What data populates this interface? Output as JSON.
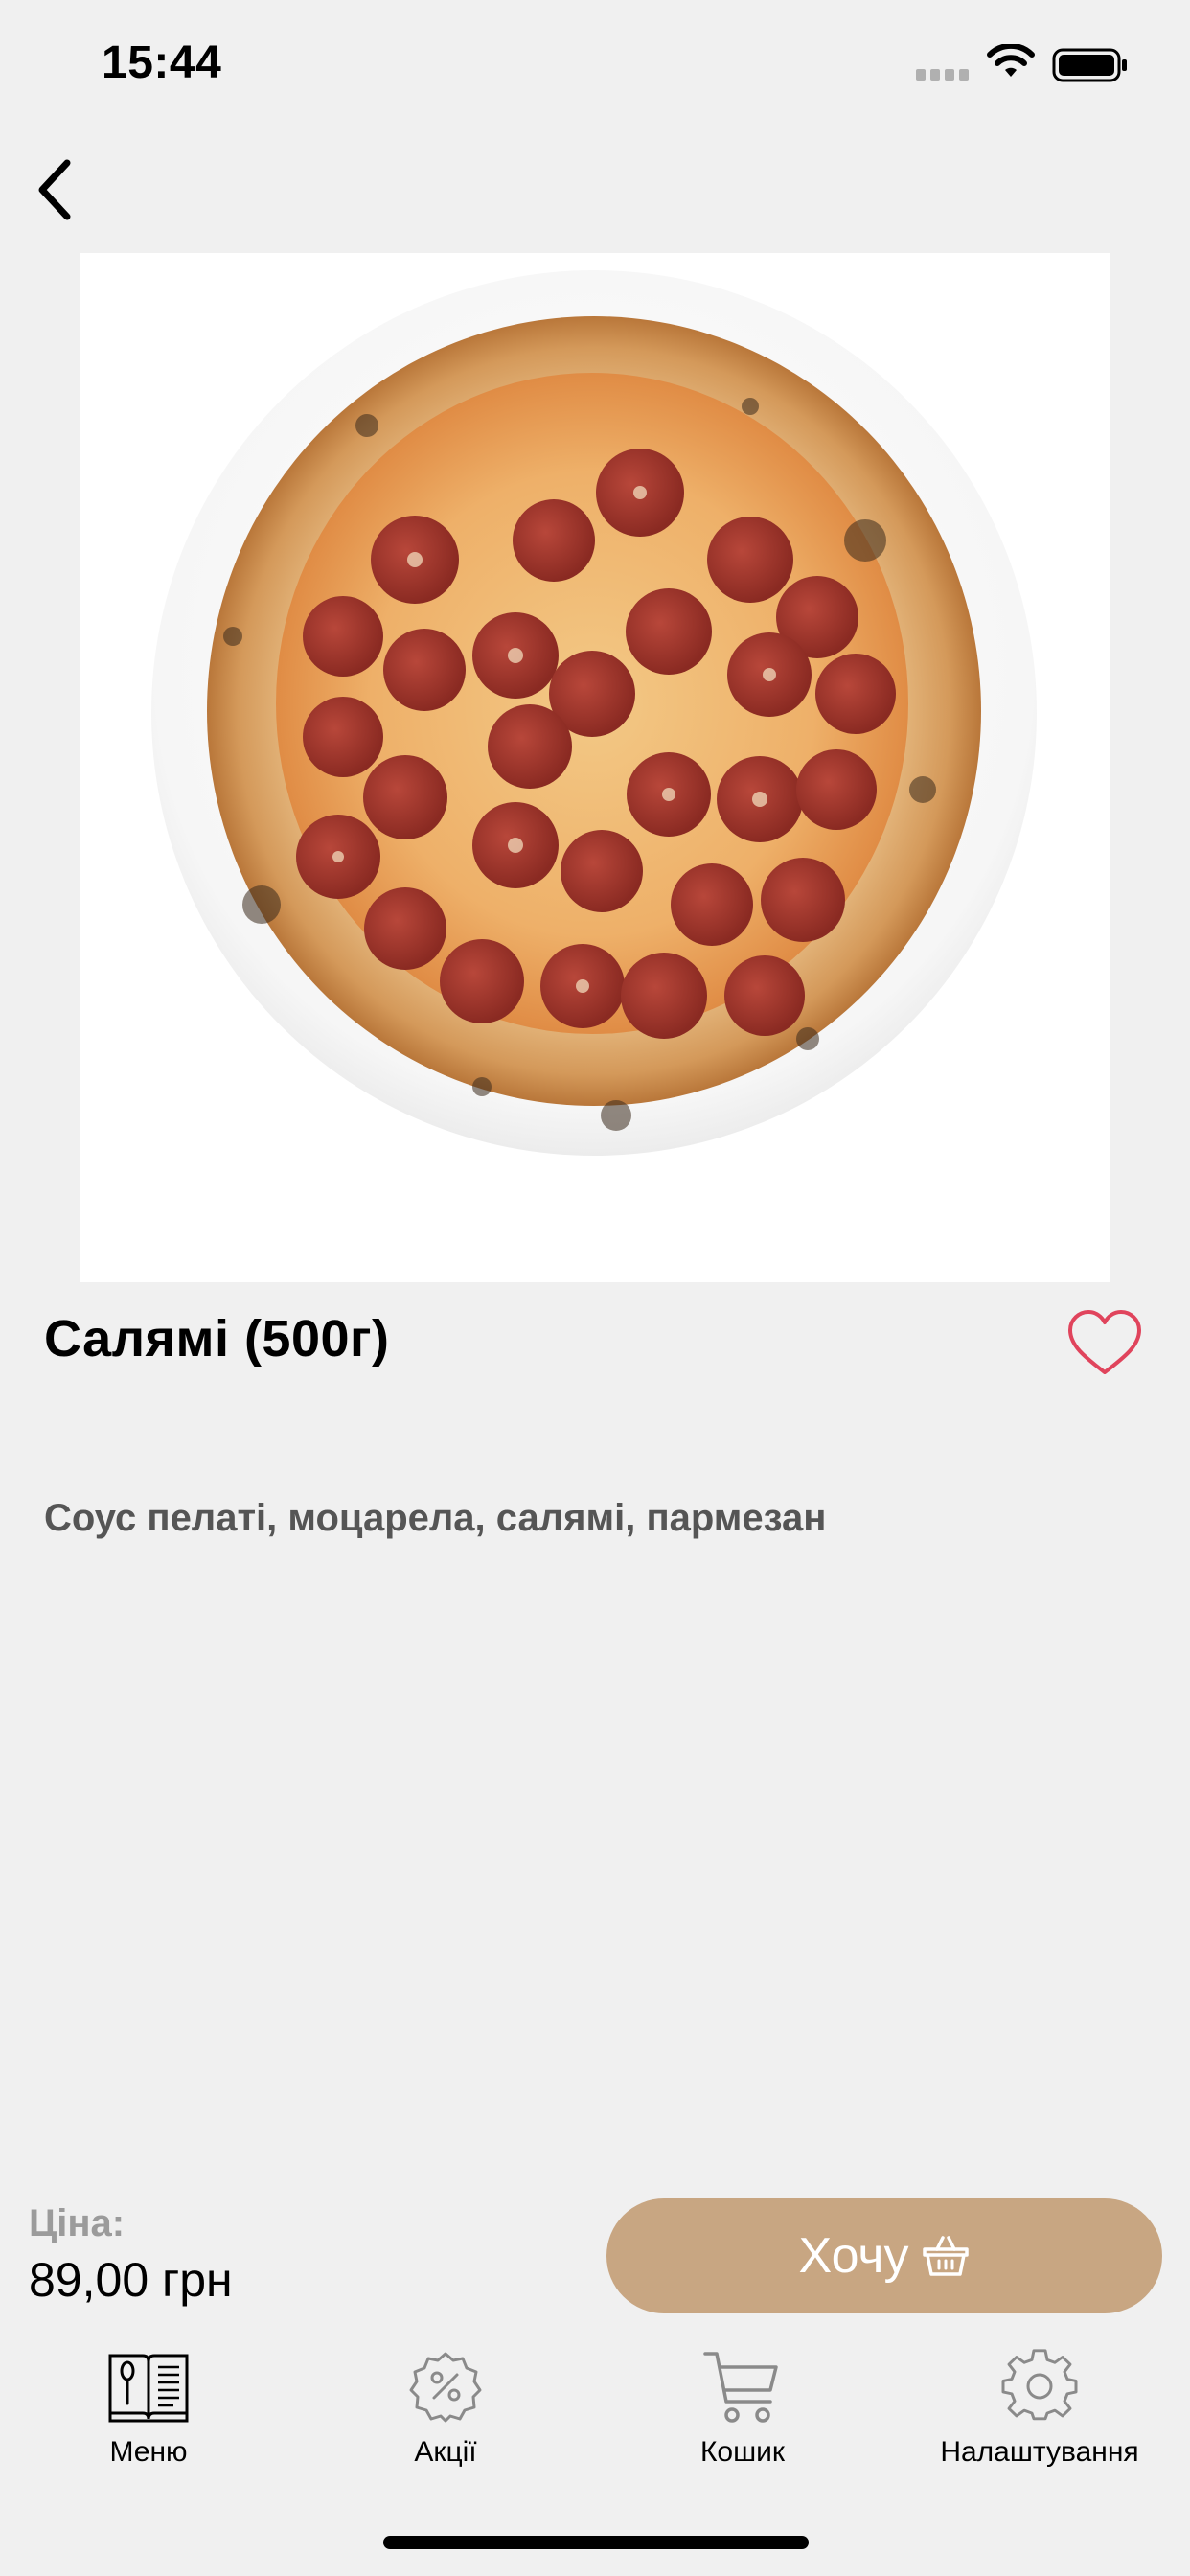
{
  "status_bar": {
    "time": "15:44"
  },
  "product": {
    "title": "Салямі (500г)",
    "description": "Соус пелаті, моцарела, салямі, пармезан",
    "image_icon": "pizza-photo"
  },
  "purchase": {
    "price_label": "Ціна:",
    "price_value": "89,00 грн",
    "want_label": "Хочу"
  },
  "tabbar": {
    "items": [
      {
        "label": "Меню",
        "icon": "menu-book-icon"
      },
      {
        "label": "Акції",
        "icon": "discount-badge-icon"
      },
      {
        "label": "Кошик",
        "icon": "cart-icon"
      },
      {
        "label": "Налаштування",
        "icon": "gear-icon"
      }
    ]
  },
  "colors": {
    "background": "#f0f0f0",
    "accent": "#c8a682",
    "favorite": "#e0445c",
    "muted_text": "#9b9b9b",
    "description_text": "#555555"
  }
}
